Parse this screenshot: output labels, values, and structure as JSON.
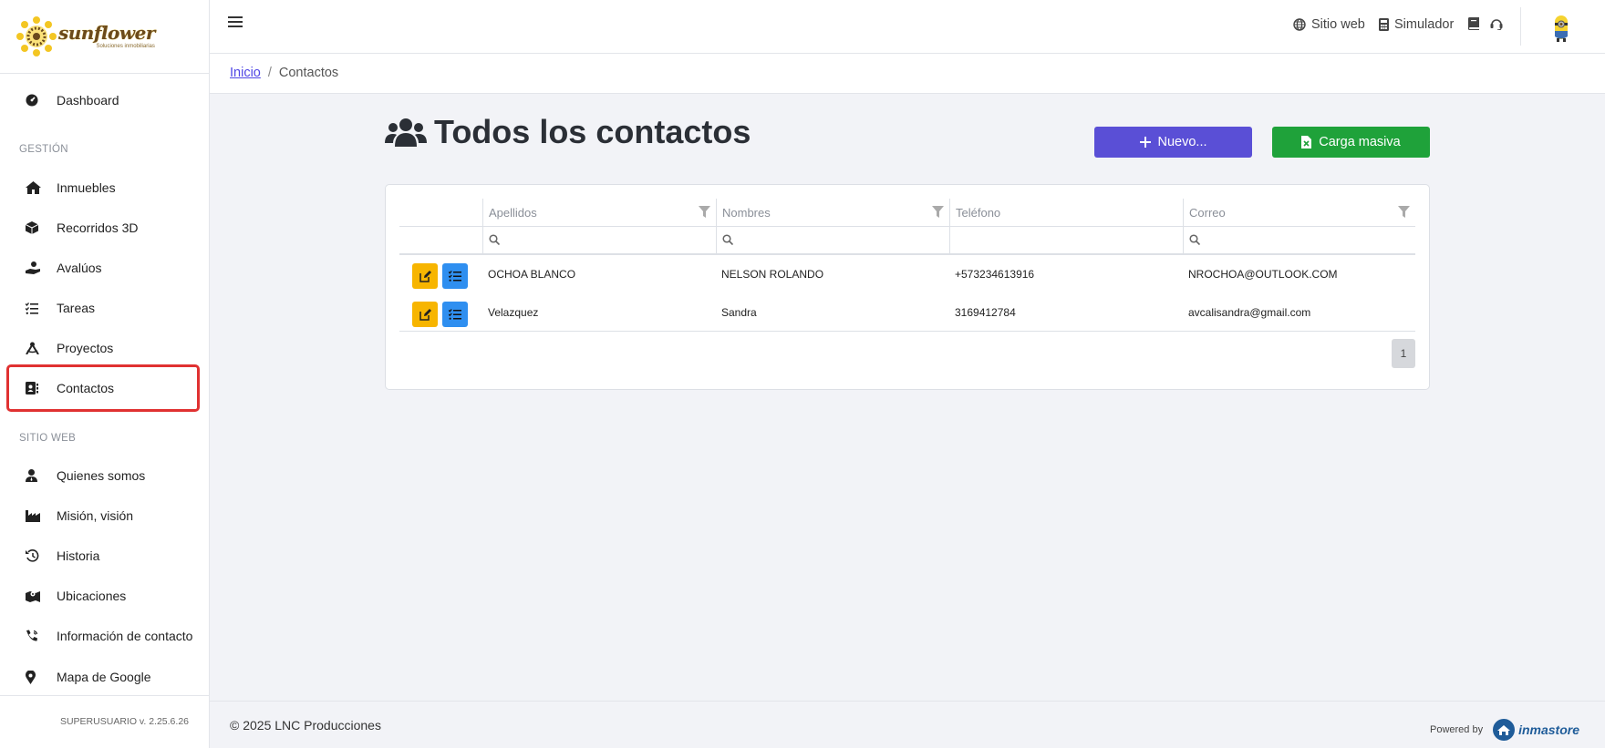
{
  "brand": {
    "logo_title": "sunflower",
    "logo_sub": "Soluciones inmobiliarias",
    "accent": "#f3c623"
  },
  "sidebar": {
    "dashboard": "Dashboard",
    "section_gestion": "GESTIÓN",
    "gestion_items": [
      {
        "label": "Inmuebles",
        "icon": "home-icon"
      },
      {
        "label": "Recorridos 3D",
        "icon": "cube-icon"
      },
      {
        "label": "Avalúos",
        "icon": "hand-coins-icon"
      },
      {
        "label": "Tareas",
        "icon": "tasks-icon"
      },
      {
        "label": "Proyectos",
        "icon": "compass-icon"
      },
      {
        "label": "Contactos",
        "icon": "address-book-icon"
      }
    ],
    "section_web": "SITIO WEB",
    "web_items": [
      {
        "label": "Quienes somos",
        "icon": "user-tie-icon"
      },
      {
        "label": "Misión, visión",
        "icon": "industry-icon"
      },
      {
        "label": "Historia",
        "icon": "history-icon"
      },
      {
        "label": "Ubicaciones",
        "icon": "map-location-icon"
      },
      {
        "label": "Información de contacto",
        "icon": "phone-volume-icon"
      },
      {
        "label": "Mapa de Google",
        "icon": "map-marker-icon"
      }
    ],
    "version": "SUPERUSUARIO v. 2.25.6.26",
    "highlight_color": "#e03131"
  },
  "topbar": {
    "site_link": "Sitio web",
    "simulator_link": "Simulador"
  },
  "breadcrumb": {
    "home": "Inicio",
    "current": "Contactos"
  },
  "page": {
    "title": "Todos los contactos",
    "new_button": "Nuevo...",
    "bulk_button": "Carga masiva"
  },
  "table": {
    "columns": [
      "Apellidos",
      "Nombres",
      "Teléfono",
      "Correo"
    ],
    "rows": [
      [
        "OCHOA BLANCO",
        "NELSON ROLANDO",
        "+573234613916",
        "NROCHOA@OUTLOOK.COM"
      ],
      [
        "Velazquez",
        "Sandra",
        "3169412784",
        "avcalisandra@gmail.com"
      ]
    ],
    "page_number": "1"
  },
  "footer": {
    "copyright": "© 2025 LNC Producciones",
    "powered_by": "Powered by",
    "powered_brand": "inmastore"
  }
}
